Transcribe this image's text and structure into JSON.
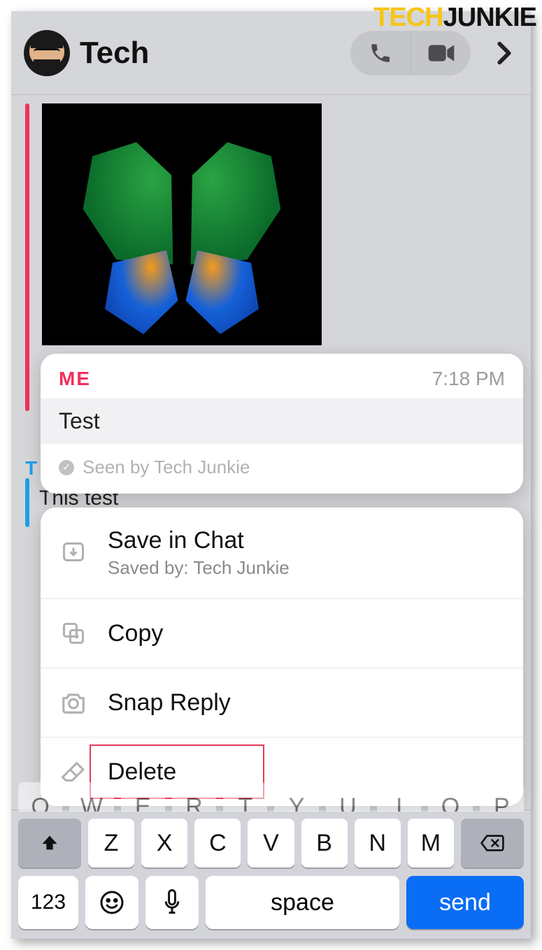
{
  "watermark": {
    "part1": "TECH",
    "part2": "JUNKIE"
  },
  "header": {
    "title": "Tech"
  },
  "chat": {
    "behind_label_partial": "T",
    "behind_message_partial": "This test"
  },
  "message_popover": {
    "sender": "ME",
    "time": "7:18 PM",
    "text": "Test",
    "seen_text": "Seen by Tech Junkie"
  },
  "context_menu": {
    "save_label": "Save in Chat",
    "save_sub": "Saved by: Tech Junkie",
    "copy_label": "Copy",
    "snap_reply_label": "Snap Reply",
    "delete_label": "Delete"
  },
  "keyboard": {
    "row_q": [
      "Q",
      "W",
      "E",
      "R",
      "T",
      "Y",
      "U",
      "I",
      "O",
      "P"
    ],
    "row_z": [
      "Z",
      "X",
      "C",
      "V",
      "B",
      "N",
      "M"
    ],
    "mode_label": "123",
    "space_label": "space",
    "send_label": "send"
  }
}
